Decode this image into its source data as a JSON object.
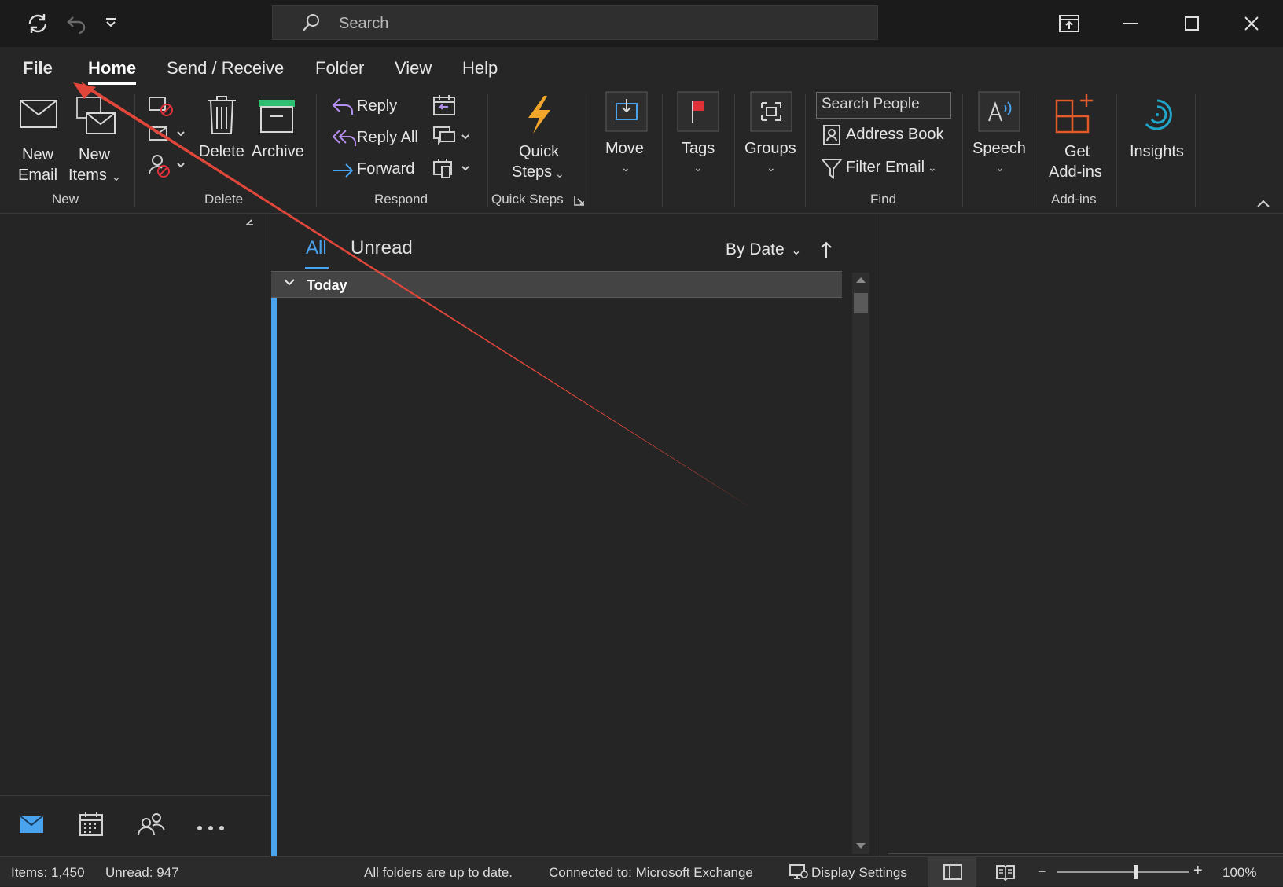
{
  "titlebar": {
    "search_placeholder": "Search"
  },
  "tabs": [
    {
      "label": "File"
    },
    {
      "label": "Home"
    },
    {
      "label": "Send / Receive"
    },
    {
      "label": "Folder"
    },
    {
      "label": "View"
    },
    {
      "label": "Help"
    }
  ],
  "ribbon": {
    "new_email": [
      "New",
      "Email"
    ],
    "new_items": [
      "New",
      "Items"
    ],
    "delete": "Delete",
    "archive": "Archive",
    "reply": "Reply",
    "reply_all": "Reply All",
    "forward": "Forward",
    "quick_steps": [
      "Quick",
      "Steps"
    ],
    "move": "Move",
    "tags": "Tags",
    "groups": "Groups",
    "search_people_placeholder": "Search People",
    "address_book": "Address Book",
    "filter_email": "Filter Email",
    "speech": "Speech",
    "get_addins": [
      "Get",
      "Add-ins"
    ],
    "insights": "Insights",
    "groups_labels": {
      "new": "New",
      "delete": "Delete",
      "respond": "Respond",
      "quick_steps": "Quick Steps",
      "find": "Find",
      "addins": "Add-ins"
    }
  },
  "message_list": {
    "filter_all": "All",
    "filter_unread": "Unread",
    "sort_label": "By Date",
    "group_header": "Today"
  },
  "statusbar": {
    "items": "Items: 1,450",
    "unread": "Unread: 947",
    "sync": "All folders are up to date.",
    "connection": "Connected to: Microsoft Exchange",
    "display_settings": "Display Settings",
    "zoom": "100%",
    "zoom_level": 0.6
  },
  "colors": {
    "accent": "#4aa3ee",
    "annotation": "#e0473a",
    "flag": "#e0303a",
    "lightning": "#f2a52b",
    "addins": "#e35a2b",
    "insights": "#1fa6c9",
    "reply": "#b48ef0",
    "forward": "#4aa3ee"
  }
}
